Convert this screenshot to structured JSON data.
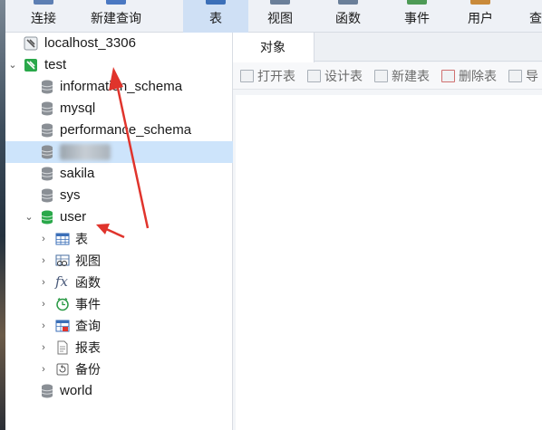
{
  "toolbar": {
    "items": [
      {
        "label": "连接",
        "icon": "connect-icon"
      },
      {
        "label": "新建查询",
        "icon": "new-query-icon"
      },
      {
        "label": "表",
        "icon": "table-icon",
        "active": true
      },
      {
        "label": "视图",
        "icon": "view-icon"
      },
      {
        "label": "函数",
        "icon": "function-icon"
      },
      {
        "label": "事件",
        "icon": "event-icon"
      },
      {
        "label": "用户",
        "icon": "user-icon"
      },
      {
        "label": "查",
        "icon": "query-icon"
      }
    ]
  },
  "tree": {
    "connection": "localhost_3306",
    "test": "test",
    "databases": {
      "information_schema": "information_schema",
      "mysql": "mysql",
      "performance_schema": "performance_schema",
      "sakila": "sakila",
      "sys": "sys",
      "user": "user",
      "world": "world"
    },
    "user_children": {
      "tables": "表",
      "views": "视图",
      "functions": "函数",
      "events": "事件",
      "queries": "查询",
      "reports": "报表",
      "backups": "备份"
    }
  },
  "right_pane": {
    "tab": "对象",
    "object_toolbar": {
      "open_table": "打开表",
      "design_table": "设计表",
      "new_table": "新建表",
      "delete_table": "删除表",
      "import": "导"
    }
  },
  "colors": {
    "selection": "#cde4fb",
    "active_tool": "#cfe0f5",
    "db_green": "#2aa84a",
    "annotation_red": "#e0342c"
  }
}
